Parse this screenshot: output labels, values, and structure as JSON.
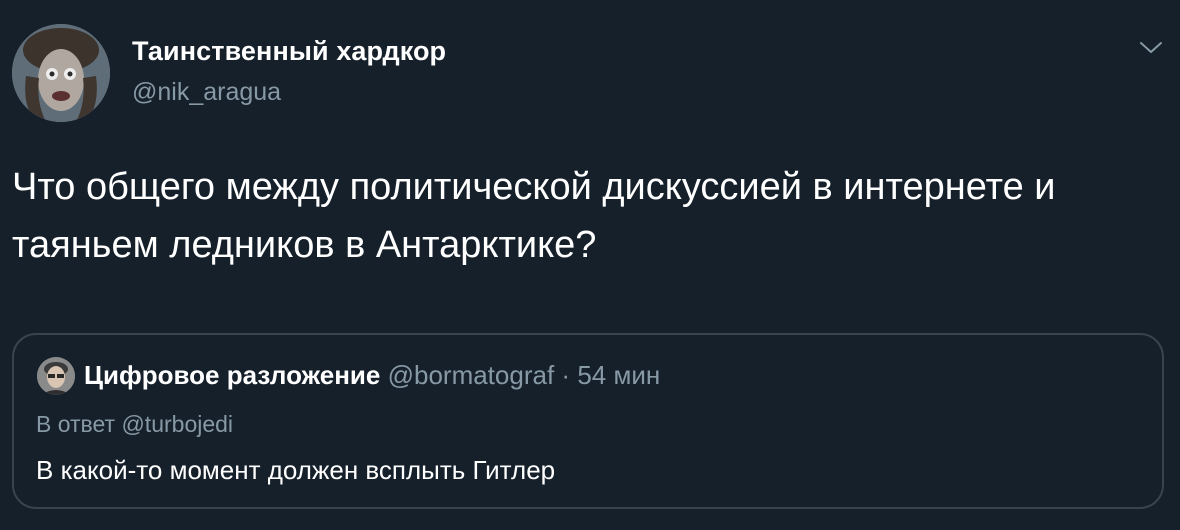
{
  "tweet": {
    "author_name": "Таинственный хардкор",
    "author_handle": "@nik_aragua",
    "text": "Что общего между политической дискуссией в интернете и таяньем ледников в Антарктике?",
    "menu_icon": "chevron-down-icon"
  },
  "quoted_tweet": {
    "author_name": "Цифровое разложение",
    "author_handle": "@bormatograf",
    "separator": "·",
    "time": "54 мин",
    "reply_to": "В ответ @turbojedi",
    "text": "В какой-то момент должен всплыть Гитлер"
  },
  "colors": {
    "background": "#15202b",
    "primary_text": "#ffffff",
    "secondary_text": "#8899a6",
    "border": "#38444d"
  }
}
